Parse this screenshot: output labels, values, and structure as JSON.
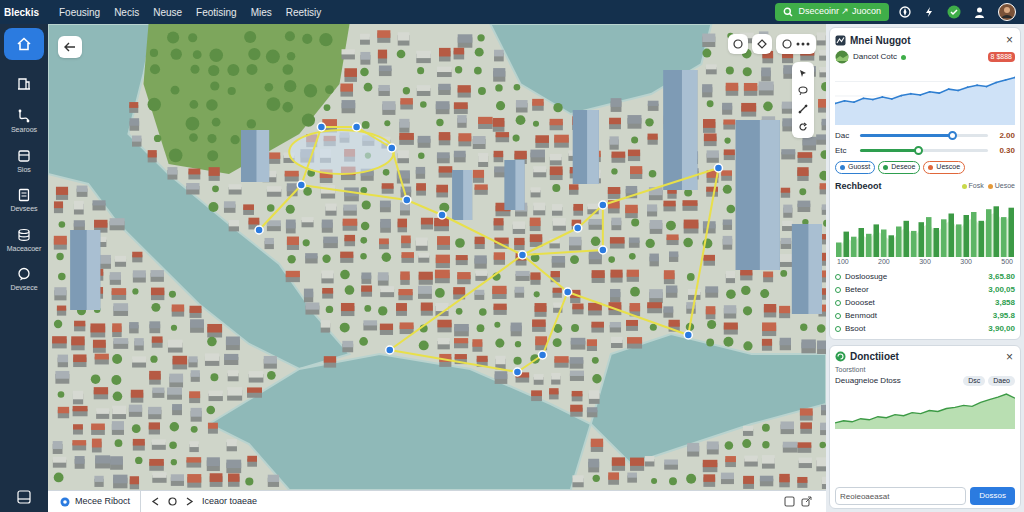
{
  "app": {
    "logo": "Bleckis"
  },
  "nav": [
    {
      "label": "Foeusing"
    },
    {
      "label": "Necis"
    },
    {
      "label": "Neuse"
    },
    {
      "label": "Feotising"
    },
    {
      "label": "Mies"
    },
    {
      "label": "Reetisiy"
    }
  ],
  "top_action": {
    "label": "Dseceoinr ↗ Juocon"
  },
  "sidebar": {
    "items": [
      {
        "selected": true
      },
      {
        "selected": false
      },
      {
        "label": "Searoos",
        "selected": false
      },
      {
        "label": "Sios",
        "selected": false
      },
      {
        "label": "Devsees",
        "selected": false
      },
      {
        "label": "Maceacoer",
        "selected": false
      },
      {
        "label": "Devsece",
        "selected": false
      }
    ]
  },
  "bottom_bar": {
    "location": "Mecee Riboct",
    "status": "Iceaor toaeae"
  },
  "summary": {
    "title": "Mnei Nuggot",
    "close": "×",
    "account": {
      "name": "Dancot Cotc",
      "online": true,
      "badge": "8 $888"
    },
    "trend": [
      30,
      34,
      32,
      38,
      36,
      40,
      37,
      42,
      45,
      43,
      48,
      46,
      52,
      50,
      55,
      58,
      56,
      62,
      66,
      70
    ],
    "sliders": [
      {
        "label": "Dac",
        "level": 0.72,
        "reading": "2.00",
        "color": "#2f7fd1"
      },
      {
        "label": "Etc",
        "level": 0.45,
        "reading": "0.30",
        "color": "#2e9e4f"
      }
    ],
    "chips": [
      {
        "label": "Guosst",
        "color": "#2f7fd1"
      },
      {
        "label": "Deseoe",
        "color": "#2e9e4f"
      },
      {
        "label": "Uescoe",
        "color": "#e0673a"
      }
    ]
  },
  "breakdown": {
    "title": "Rechbeoot",
    "legend": [
      {
        "label": "Fosk",
        "color": "#c9d94a"
      },
      {
        "label": "Uesoe",
        "color": "#e59a3a"
      }
    ],
    "bars": [
      20,
      35,
      28,
      40,
      32,
      45,
      38,
      30,
      42,
      50,
      36,
      48,
      55,
      40,
      52,
      60,
      45,
      58,
      62,
      50,
      66,
      70,
      55,
      68
    ],
    "ticks": [
      "100",
      "200",
      "300",
      "300",
      "500"
    ],
    "rows": [
      {
        "label": "Dosloosuge",
        "value": "3,65.80"
      },
      {
        "label": "Beteor",
        "value": "3,00,05"
      },
      {
        "label": "Doooset",
        "value": "3,858"
      },
      {
        "label": "Benmodt",
        "value": "3,95.8"
      },
      {
        "label": "Bsoot",
        "value": "3,90,00"
      }
    ]
  },
  "contact": {
    "title": "Donctiioet",
    "close": "×",
    "subtitle": "Toorstiont",
    "caption": "Deuagneioe Dtoss",
    "tags": [
      "Dsc",
      "Daeo"
    ],
    "series": [
      10,
      14,
      12,
      18,
      16,
      22,
      20,
      26,
      24,
      30,
      28,
      34,
      32,
      38,
      40,
      44,
      42,
      50,
      55,
      60,
      66,
      58
    ],
    "input": {
      "placeholder": "Reoieoaeasat"
    },
    "button": "Dossos"
  }
}
